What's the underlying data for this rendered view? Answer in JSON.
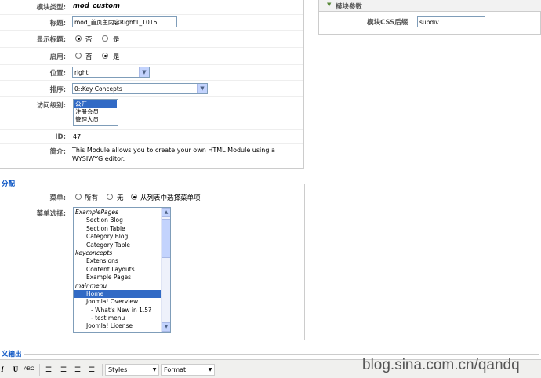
{
  "details": {
    "module_type_label": "模块类型:",
    "module_type_value": "mod_custom",
    "title_label": "标题:",
    "title_value": "mod_首页主内容Right1_1016",
    "show_title_label": "显示标题:",
    "show_title_no": "否",
    "show_title_yes": "是",
    "enabled_label": "启用:",
    "enabled_no": "否",
    "enabled_yes": "是",
    "position_label": "位置:",
    "position_value": "right",
    "order_label": "排序:",
    "order_value": "0::Key Concepts",
    "access_label": "访问级别:",
    "access_options": [
      "公开",
      "注册会员",
      "管理人员"
    ],
    "id_label": "ID:",
    "id_value": "47",
    "description_label": "简介:",
    "description_value": "This Module allows you to create your own HTML Module using a WYSIWYG editor."
  },
  "params": {
    "header": "模块参数",
    "css_suffix_label": "模块CSS后缀",
    "css_suffix_value": "subdiv"
  },
  "assignment": {
    "legend": "分配",
    "menus_label": "菜单:",
    "opt_all": "所有",
    "opt_none": "无",
    "opt_select": "从列表中选择菜单项",
    "selection_label": "菜单选择:",
    "items": [
      {
        "text": "ExamplePages",
        "kind": "grp"
      },
      {
        "text": "Section Blog",
        "kind": "l1"
      },
      {
        "text": "Section Table",
        "kind": "l1"
      },
      {
        "text": "Category Blog",
        "kind": "l1"
      },
      {
        "text": "Category Table",
        "kind": "l1"
      },
      {
        "text": "keyconcepts",
        "kind": "grp"
      },
      {
        "text": "Extensions",
        "kind": "l1"
      },
      {
        "text": "Content Layouts",
        "kind": "l1"
      },
      {
        "text": "Example Pages",
        "kind": "l1"
      },
      {
        "text": "mainmenu",
        "kind": "grp"
      },
      {
        "text": "Home",
        "kind": "l1",
        "selected": true
      },
      {
        "text": "Joomla! Overview",
        "kind": "l1"
      },
      {
        "text": "- What's New in 1.5?",
        "kind": "l2"
      },
      {
        "text": "- test menu",
        "kind": "l2"
      },
      {
        "text": "Joomla! License",
        "kind": "l1"
      }
    ]
  },
  "custom_output": {
    "legend": "义输出"
  },
  "editor_toolbar": {
    "styles_label": "Styles",
    "format_label": "Format"
  },
  "watermark": "blog.sina.com.cn/qandq"
}
